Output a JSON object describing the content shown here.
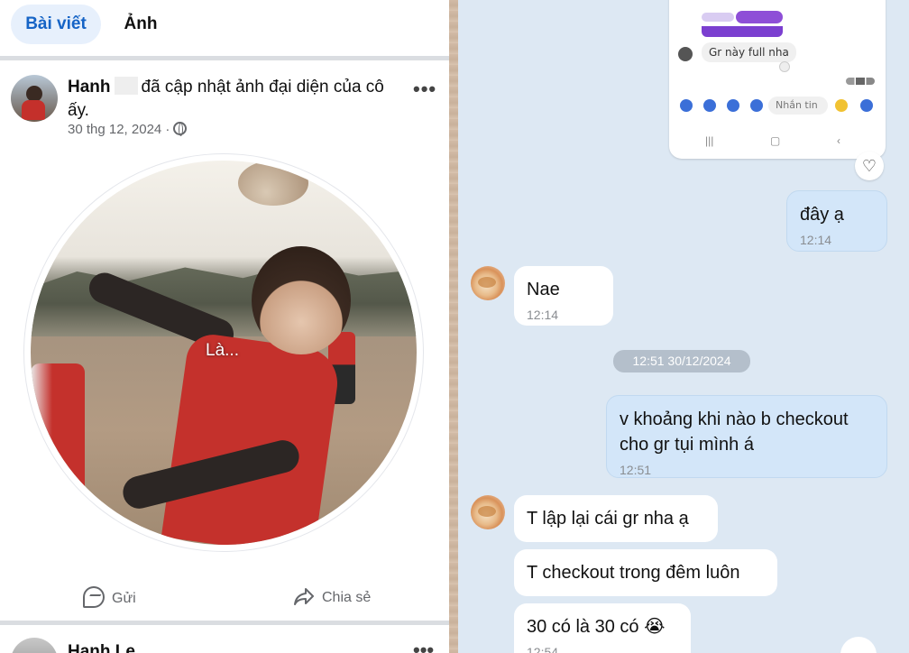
{
  "tabs": {
    "posts": "Bài viết",
    "photos": "Ảnh"
  },
  "post": {
    "author": "Hanh",
    "action_text": "đã cập nhật ảnh đại diện của cô ấy.",
    "date": "30 thg 12, 2024 ·",
    "photo_caption": "Là...",
    "send_label": "Gửi",
    "share_label": "Chia sẻ"
  },
  "next_post": {
    "author": "Hanh Le"
  },
  "chat": {
    "screenshot": {
      "bubble": "Gr này full nha",
      "input_placeholder": "Nhắn tin"
    },
    "messages": [
      {
        "side": "out",
        "text": "đây ạ",
        "time": "12:14"
      },
      {
        "side": "in",
        "text": "Nae",
        "time": "12:14"
      },
      {
        "side": "out",
        "text": "v khoảng khi nào b checkout cho gr tụi mình á",
        "time": "12:51"
      },
      {
        "side": "in",
        "text": "T lập lại cái gr nha ạ",
        "time": ""
      },
      {
        "side": "in",
        "text": "T checkout trong đêm luôn",
        "time": ""
      },
      {
        "side": "in",
        "text": "30 có là 30 có 😭",
        "time": "12:54"
      }
    ],
    "date_separator": "12:51 30/12/2024"
  },
  "colors": {
    "accent": "#1664c6",
    "chat_bg": "#dde8f3",
    "outgoing_bubble": "#d3e6f9",
    "incoming_bubble": "#ffffff"
  }
}
